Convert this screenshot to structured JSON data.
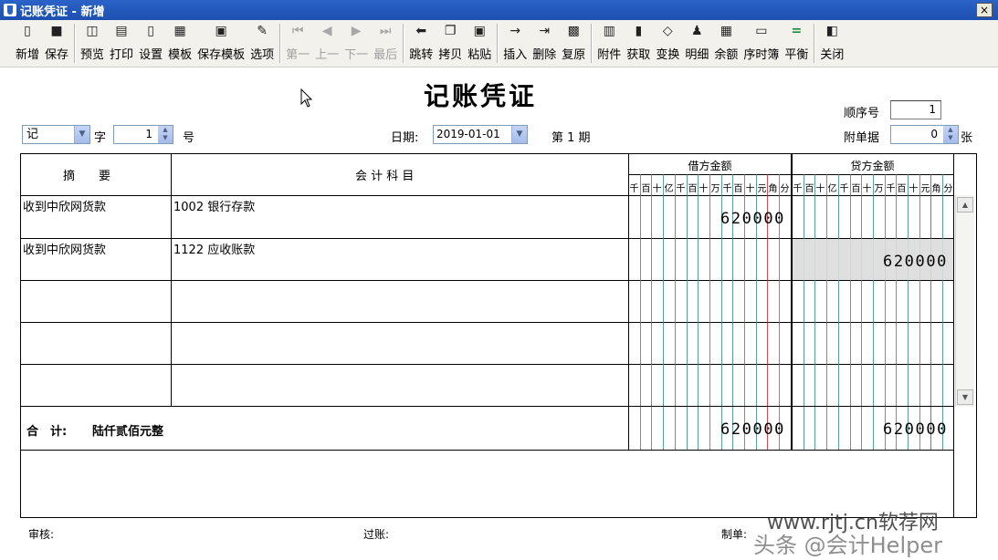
{
  "window": {
    "title": "记账凭证 - 新增",
    "close_label": "×"
  },
  "toolbar": {
    "buttons": [
      {
        "label": "新增",
        "icon": "new-doc-icon"
      },
      {
        "label": "保存",
        "icon": "save-icon"
      },
      {
        "label": "预览",
        "icon": "preview-icon"
      },
      {
        "label": "打印",
        "icon": "print-icon"
      },
      {
        "label": "设置",
        "icon": "settings-icon"
      },
      {
        "label": "模板",
        "icon": "template-icon"
      },
      {
        "label": "保存模板",
        "icon": "save-template-icon"
      },
      {
        "label": "选项",
        "icon": "options-icon"
      },
      {
        "label": "第一",
        "icon": "first-icon"
      },
      {
        "label": "上一",
        "icon": "prev-icon"
      },
      {
        "label": "下一",
        "icon": "next-icon"
      },
      {
        "label": "最后",
        "icon": "last-icon"
      },
      {
        "label": "跳转",
        "icon": "jump-icon"
      },
      {
        "label": "拷贝",
        "icon": "copy-icon"
      },
      {
        "label": "粘贴",
        "icon": "paste-icon"
      },
      {
        "label": "插入",
        "icon": "insert-icon"
      },
      {
        "label": "删除",
        "icon": "delete-icon"
      },
      {
        "label": "复原",
        "icon": "restore-icon"
      },
      {
        "label": "附件",
        "icon": "attachment-icon"
      },
      {
        "label": "获取",
        "icon": "fetch-icon"
      },
      {
        "label": "变换",
        "icon": "transform-icon"
      },
      {
        "label": "明细",
        "icon": "detail-icon"
      },
      {
        "label": "余额",
        "icon": "balance-icon"
      },
      {
        "label": "序时簿",
        "icon": "journal-icon"
      },
      {
        "label": "平衡",
        "icon": "equal-icon"
      },
      {
        "label": "关闭",
        "icon": "close-door-icon"
      }
    ]
  },
  "voucher": {
    "title": "记账凭证",
    "seq_label": "顺序号",
    "seq_value": "1",
    "word_value": "记",
    "word_suffix": "字",
    "number_value": "1",
    "number_suffix": "号",
    "date_label": "日期:",
    "date_value": "2019-01-01",
    "period_label": "第 1 期",
    "attach_label": "附单据",
    "attach_value": "0",
    "attach_suffix": "张"
  },
  "grid": {
    "col_summary": "摘　　要",
    "col_account": "会 计 科 目",
    "col_debit": "借方金额",
    "col_credit": "贷方金额",
    "digit_headers": [
      "千",
      "百",
      "十",
      "亿",
      "千",
      "百",
      "十",
      "万",
      "千",
      "百",
      "十",
      "元",
      "角",
      "分"
    ],
    "rows": [
      {
        "summary": "收到中欣网货款",
        "account": "1002 银行存款",
        "debit": "620000",
        "credit": ""
      },
      {
        "summary": "收到中欣网货款",
        "account": "1122 应收账款",
        "debit": "",
        "credit": "620000"
      },
      {
        "summary": "",
        "account": "",
        "debit": "",
        "credit": ""
      },
      {
        "summary": "",
        "account": "",
        "debit": "",
        "credit": ""
      },
      {
        "summary": "",
        "account": "",
        "debit": "",
        "credit": ""
      }
    ],
    "total_label": "合　计:",
    "total_words": "陆仟贰佰元整",
    "total_debit": "620000",
    "total_credit": "620000"
  },
  "footer": {
    "review_label": "审核:",
    "post_label": "过账:",
    "maker_label": "制单:"
  },
  "watermark": {
    "text1": "www.rjtj.cn软荐网",
    "text2": "头条 @会计Helper"
  },
  "colors": {
    "red_line": "#d42020",
    "teal_line": "#2a8a8a",
    "title_bar": "#2b63c8"
  }
}
